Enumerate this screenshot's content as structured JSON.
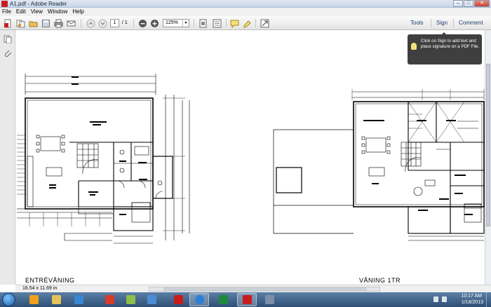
{
  "window": {
    "title": "A1.pdf - Adobe Reader"
  },
  "menu": [
    "File",
    "Edit",
    "View",
    "Window",
    "Help"
  ],
  "toolbar": {
    "page_current": "1",
    "page_total": "/ 1",
    "zoom": "125%",
    "tools_label": "Tools",
    "sign_label": "Sign",
    "comment_label": "Comment"
  },
  "tooltip": {
    "text": "Click on Sign to add text and place signature on a PDF File."
  },
  "document": {
    "left_floor_label": "ENTRÉVÅNING",
    "right_floor_label": "VÅNING 1TR",
    "page_size": "16.54 x 11.69 in"
  },
  "taskbar": {
    "time": "10:17 AM",
    "date": "1/18/2013",
    "apps": [
      "internet-explorer",
      "outlook",
      "file-explorer",
      "media-player",
      "app-5",
      "app-6",
      "app-7",
      "app-8",
      "rsa",
      "ie-browser",
      "excel",
      "adobe-reader",
      "app-13"
    ]
  },
  "colors": {
    "accent": "#1f3f6b",
    "taskbar": "#2f4f76",
    "reader_red": "#c81c1c"
  }
}
